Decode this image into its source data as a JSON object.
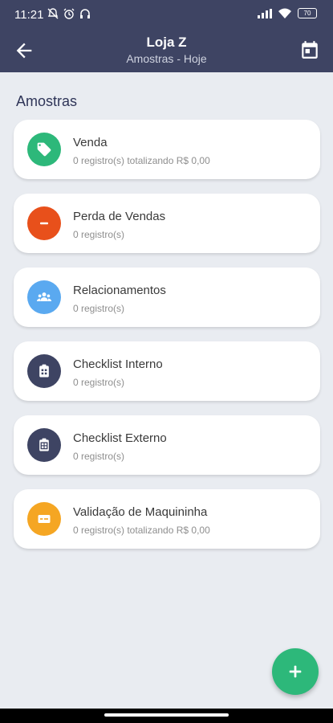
{
  "status_bar": {
    "time": "11:21",
    "battery": "70",
    "icons": [
      "notification-off-icon",
      "alarm-icon",
      "headphones-icon",
      "signal-icon",
      "wifi-icon",
      "battery-icon"
    ]
  },
  "app_bar": {
    "title": "Loja Z",
    "subtitle": "Amostras - Hoje",
    "back_icon": "arrow-left-icon",
    "action_icon": "calendar-icon",
    "background": "#3e4463"
  },
  "section": {
    "title": "Amostras"
  },
  "cards": [
    {
      "title": "Venda",
      "subtitle": "0 registro(s) totalizando R$ 0,00",
      "icon": "tag-icon",
      "color": "#2db87a"
    },
    {
      "title": "Perda de Vendas",
      "subtitle": "0 registro(s)",
      "icon": "minus-icon",
      "color": "#e8501b"
    },
    {
      "title": "Relacionamentos",
      "subtitle": "0 registro(s)",
      "icon": "people-icon",
      "color": "#5aa9f0"
    },
    {
      "title": "Checklist Interno",
      "subtitle": "0 registro(s)",
      "icon": "clipboard-list-icon",
      "color": "#3e4463"
    },
    {
      "title": "Checklist Externo",
      "subtitle": "0 registro(s)",
      "icon": "clipboard-grid-icon",
      "color": "#3e4463"
    },
    {
      "title": "Validação de Maquininha",
      "subtitle": "0 registro(s) totalizando R$ 0,00",
      "icon": "card-icon",
      "color": "#f5a623"
    }
  ],
  "fab": {
    "icon": "plus-icon",
    "color": "#2db87a"
  }
}
